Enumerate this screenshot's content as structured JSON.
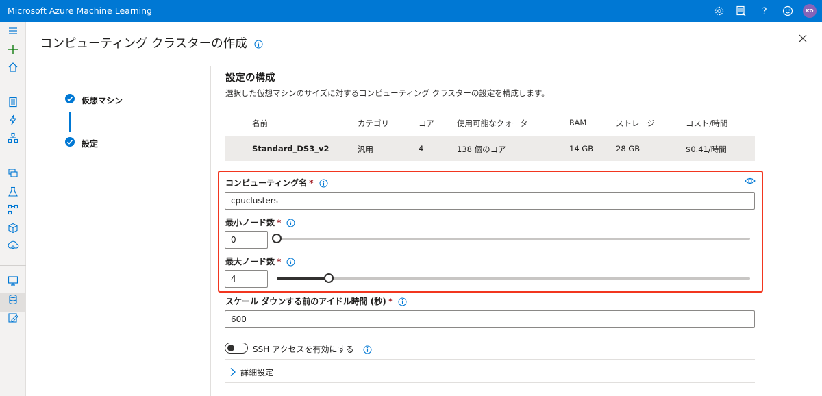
{
  "app": {
    "title": "Microsoft Azure Machine Learning",
    "user_initials": "KO"
  },
  "topbar_icons": [
    "gear-icon",
    "feedback-icon",
    "help-icon",
    "smiley-icon"
  ],
  "page": {
    "title": "コンピューティング クラスターの作成"
  },
  "steps": [
    {
      "label": "仮想マシン",
      "state": "completed"
    },
    {
      "label": "設定",
      "state": "current"
    }
  ],
  "section": {
    "title": "設定の構成",
    "description": "選択した仮想マシンのサイズに対するコンピューティング クラスターの設定を構成します。"
  },
  "vm_table": {
    "headers": [
      "名前",
      "カテゴリ",
      "コア",
      "使用可能なクォータ",
      "RAM",
      "ストレージ",
      "コスト/時間"
    ],
    "row": [
      "Standard_DS3_v2",
      "汎用",
      "4",
      "138 個のコア",
      "14 GB",
      "28 GB",
      "$0.41/時間"
    ]
  },
  "form": {
    "compute_name": {
      "label": "コンピューティング名",
      "required": "*",
      "value": "cpuclusters"
    },
    "min_nodes": {
      "label": "最小ノード数",
      "required": "*",
      "value": "0",
      "slider_fraction": 0.0
    },
    "max_nodes": {
      "label": "最大ノード数",
      "required": "*",
      "value": "4",
      "slider_fraction": 0.11
    },
    "idle_time": {
      "label": "スケール ダウンする前のアイドル時間 (秒)",
      "required": "*",
      "value": "600"
    },
    "ssh": {
      "label": "SSH アクセスを有効にする",
      "enabled": false
    },
    "advanced": {
      "label": "詳細設定"
    }
  },
  "colors": {
    "brand": "#0078d4",
    "highlight": "#f2361f",
    "required": "#a4262c"
  }
}
